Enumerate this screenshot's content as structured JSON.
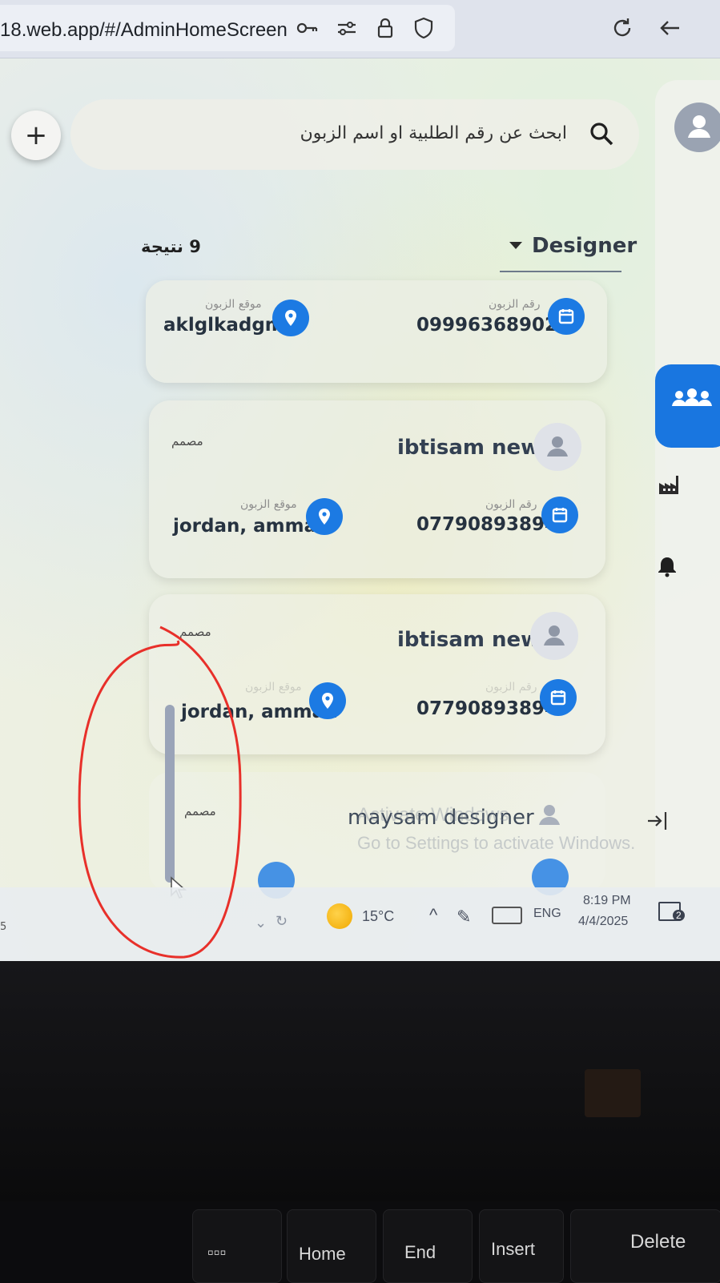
{
  "browser": {
    "url": "18.web.app/#/AdminHomeScreen"
  },
  "search": {
    "placeholder": "ابحث عن رقم الطلبية او اسم الزبون"
  },
  "results": {
    "count_label": "9 نتيجة"
  },
  "filter": {
    "selected": "Designer"
  },
  "captions": {
    "customer_location": "موقع الزبون",
    "customer_number": "رقم الزبون"
  },
  "cards": [
    {
      "location": "aklglkadgm",
      "phone": "09996368902"
    },
    {
      "name": "ibtisam new",
      "role": "مصمم",
      "location": "jordan, amman",
      "phone": "07790893894"
    },
    {
      "name": "ibtisam new",
      "role": "مصمم",
      "location": "jordan, amman",
      "phone": "07790893894"
    },
    {
      "name": "maysam designer",
      "role": "مصمم"
    }
  ],
  "windows_watermark": {
    "line1": "Activate Windows",
    "line2": "Go to Settings to activate Windows."
  },
  "taskbar": {
    "temperature": "15°C",
    "language": "ENG",
    "time": "8:19 PM",
    "date": "4/4/2025",
    "notification_count": "2"
  },
  "keyboard": {
    "keys": [
      "Home",
      "End",
      "Insert",
      "Delete"
    ]
  },
  "colors": {
    "accent": "#1976e0",
    "annotation": "#e8302a"
  }
}
